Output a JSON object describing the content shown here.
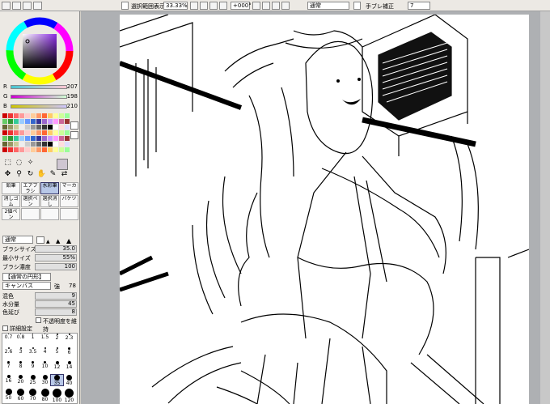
{
  "toolbar": {
    "selection_checkbox_label": "選択範囲表示",
    "zoom": "33.33%",
    "rotation": "+000°",
    "blend_mode": "通常",
    "stabilizer_label": "手ブレ補正",
    "stabilizer_value": "7"
  },
  "color": {
    "current_hex": "#5b1d75",
    "sliders": [
      {
        "label": "R",
        "value": "207"
      },
      {
        "label": "G",
        "value": "198"
      },
      {
        "label": "B",
        "value": "210"
      }
    ]
  },
  "tools": {
    "group_labels": [
      "鉛筆",
      "エアブラシ",
      "水彩筆",
      "マーカー",
      "消しゴム",
      "選択ペン",
      "選択消し",
      "バケツ",
      "2値ペン"
    ]
  },
  "brush": {
    "blend": "通常",
    "params": [
      {
        "label": "ブラシサイズ",
        "value": "35.0"
      },
      {
        "label": "最小サイズ",
        "value": "55%"
      },
      {
        "label": "ブラシ濃度",
        "value": "100"
      }
    ],
    "shape_label": "【通常の円形】",
    "texture_label": "キャンバス",
    "texture_strength_label": "強",
    "texture_value": "78",
    "mix": [
      {
        "label": "混色",
        "value": "9"
      },
      {
        "label": "水分量",
        "value": "45"
      },
      {
        "label": "色延び",
        "value": "8"
      }
    ],
    "keep_opacity_label": "不透明度を維持",
    "detail_label": "詳細設定",
    "size_presets": [
      "0.7",
      "0.8",
      "1",
      "1.5",
      "2",
      "2.3",
      "2.6",
      "3",
      "3.5",
      "4",
      "5",
      "6",
      "7",
      "8",
      "9",
      "10",
      "12",
      "14",
      "16",
      "20",
      "25",
      "30",
      "35",
      "40",
      "50",
      "60",
      "70",
      "80",
      "100",
      "120"
    ]
  }
}
